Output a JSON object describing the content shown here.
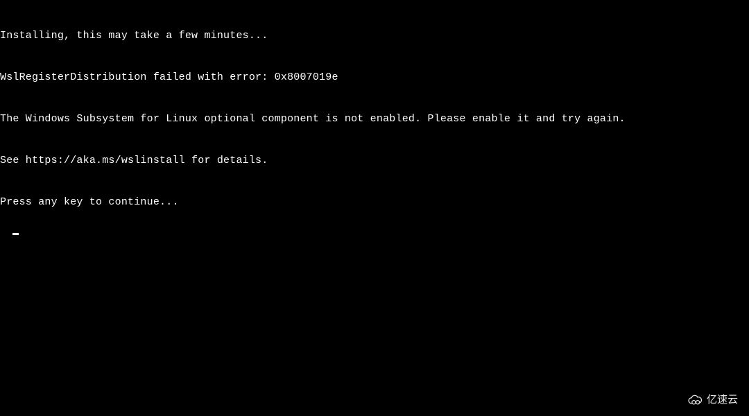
{
  "terminal": {
    "lines": [
      "Installing, this may take a few minutes...",
      "WslRegisterDistribution failed with error: 0x8007019e",
      "The Windows Subsystem for Linux optional component is not enabled. Please enable it and try again.",
      "See https://aka.ms/wslinstall for details.",
      "Press any key to continue..."
    ]
  },
  "watermark": {
    "text": "亿速云"
  }
}
